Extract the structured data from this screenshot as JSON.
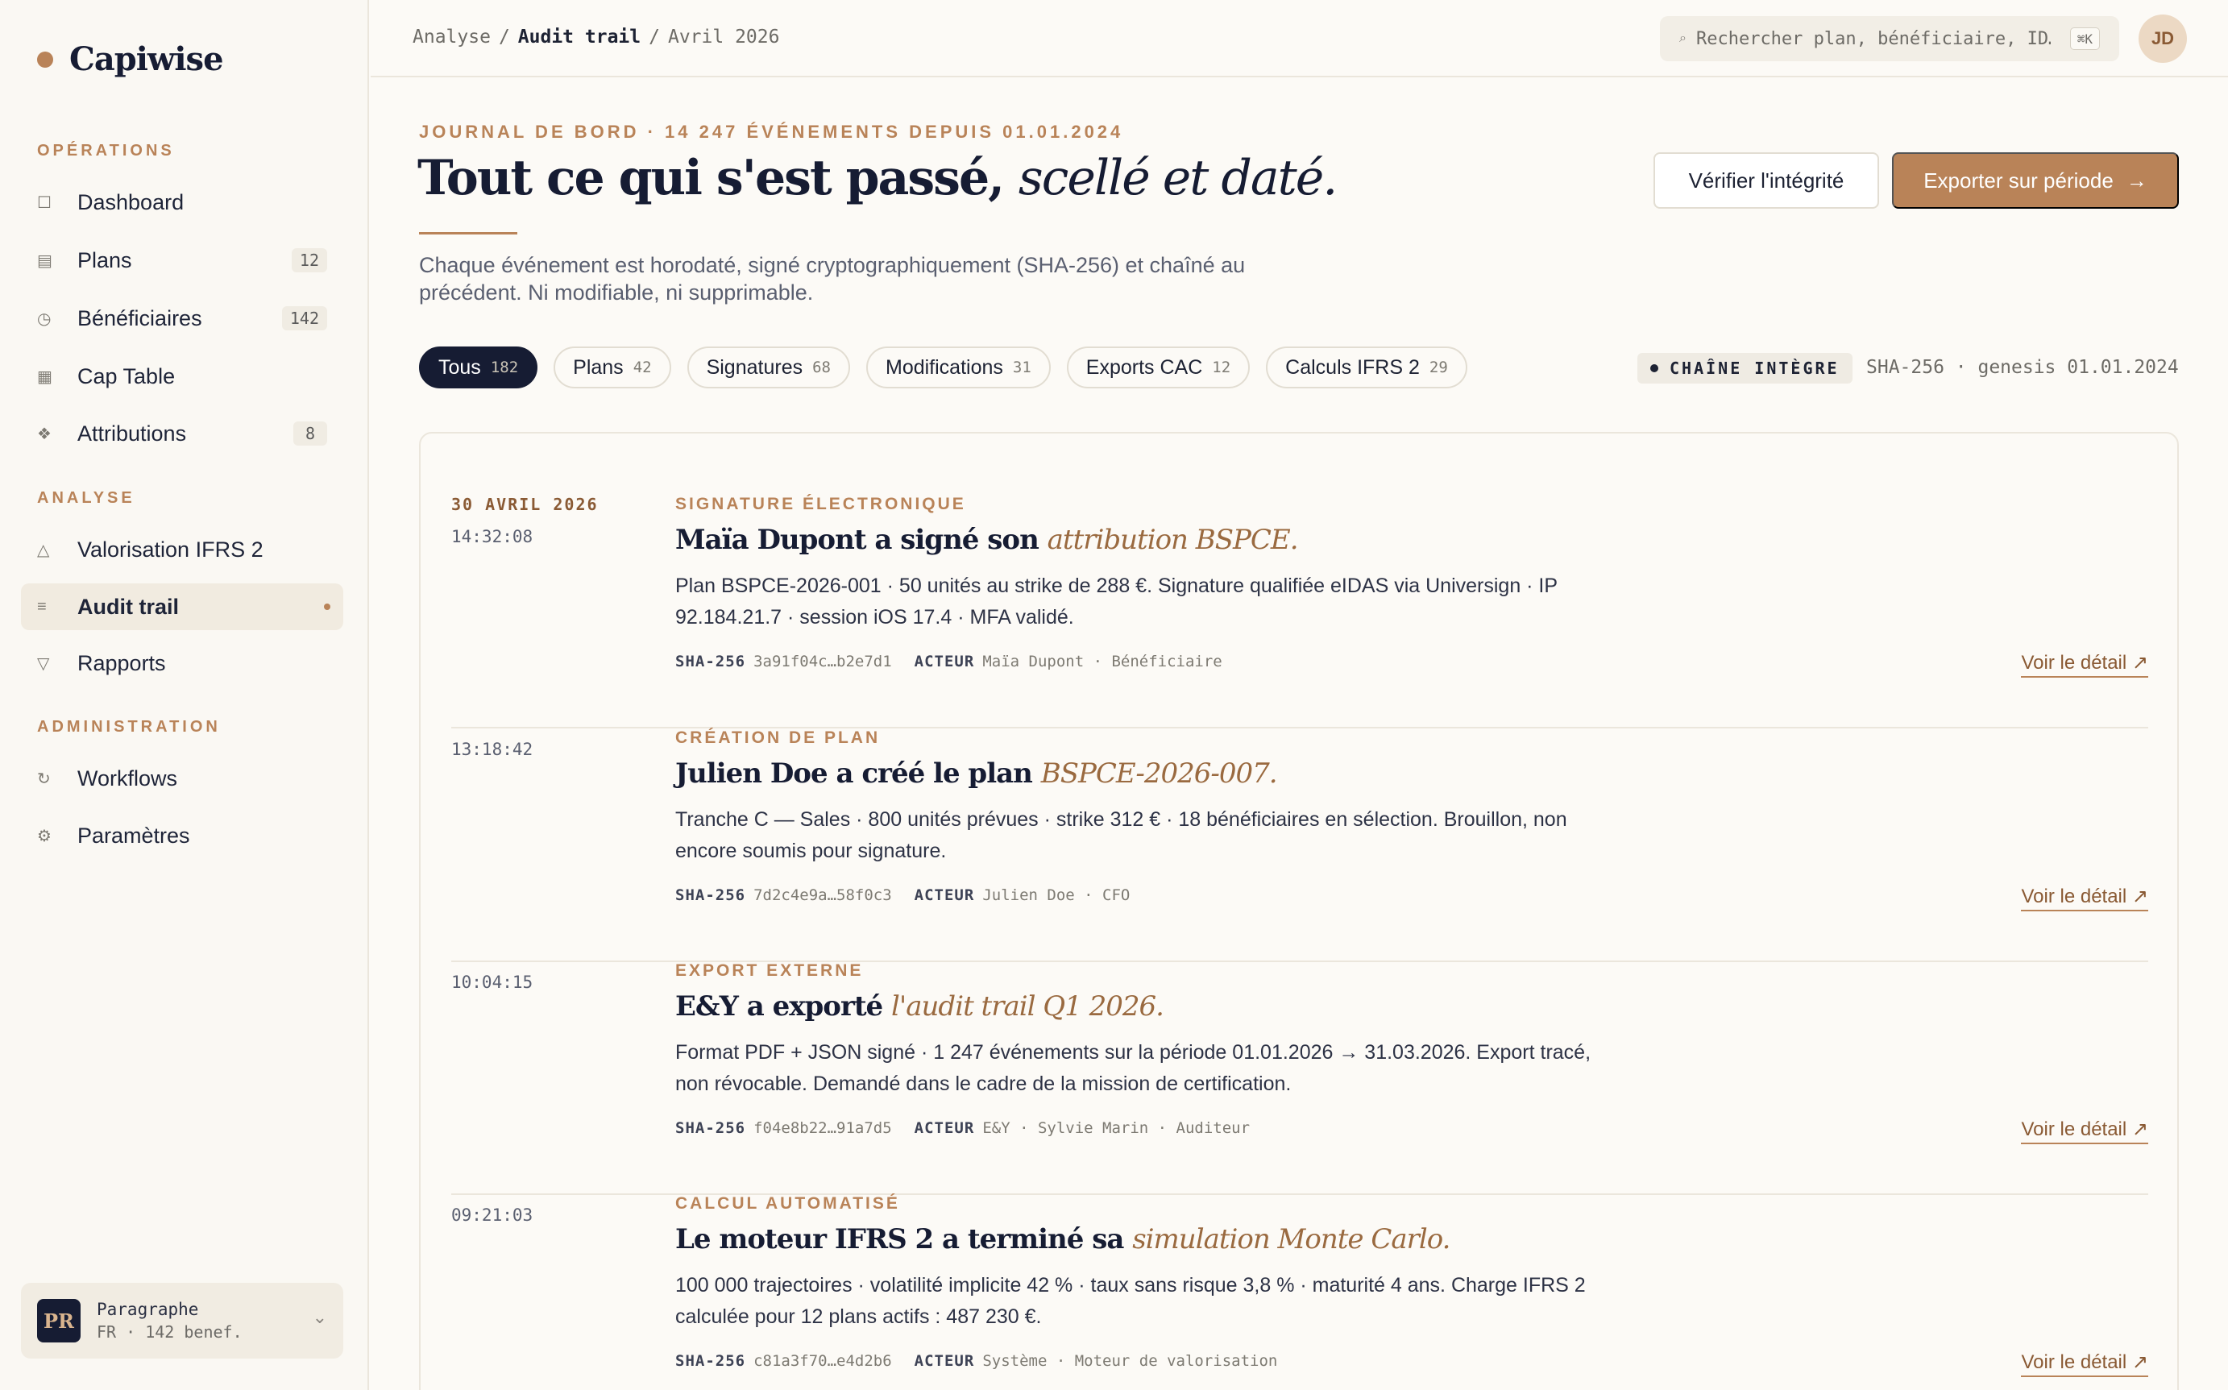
{
  "brand": {
    "name": "Capiwise"
  },
  "sidebar": {
    "sections": [
      {
        "label": "OPÉRATIONS",
        "items": [
          {
            "icon": "square-icon",
            "glyph": "☐",
            "label": "Dashboard",
            "badge": ""
          },
          {
            "icon": "plans-icon",
            "glyph": "▤",
            "label": "Plans",
            "badge": "12"
          },
          {
            "icon": "clock-icon",
            "glyph": "◷",
            "label": "Bénéficiaires",
            "badge": "142"
          },
          {
            "icon": "table-icon",
            "glyph": "▦",
            "label": "Cap Table",
            "badge": ""
          },
          {
            "icon": "attributions-icon",
            "glyph": "❖",
            "label": "Attributions",
            "badge": "8"
          }
        ]
      },
      {
        "label": "ANALYSE",
        "items": [
          {
            "icon": "triangle-icon",
            "glyph": "△",
            "label": "Valorisation IFRS 2",
            "badge": ""
          },
          {
            "icon": "list-icon",
            "glyph": "≡",
            "label": "Audit trail",
            "badge": "",
            "active": true
          },
          {
            "icon": "triangle-down-icon",
            "glyph": "▽",
            "label": "Rapports",
            "badge": ""
          }
        ]
      },
      {
        "label": "ADMINISTRATION",
        "items": [
          {
            "icon": "refresh-icon",
            "glyph": "↻",
            "label": "Workflows",
            "badge": ""
          },
          {
            "icon": "gear-icon",
            "glyph": "⚙",
            "label": "Paramètres",
            "badge": ""
          }
        ]
      }
    ],
    "workspace": {
      "initials": "PR",
      "name": "Paragraphe",
      "meta": "FR · 142 benef.",
      "chevron": "⌄"
    }
  },
  "topbar": {
    "breadcrumb": [
      "Analyse",
      "Audit trail",
      "Avril 2026"
    ],
    "search": {
      "placeholder": "Rechercher plan, bénéficiaire, ID…",
      "shortcut": "⌘K",
      "icon": "⌕"
    },
    "user_initials": "JD"
  },
  "header": {
    "eyebrow": "JOURNAL DE BORD · 14 247 ÉVÉNEMENTS DEPUIS 01.01.2024",
    "title_main": "Tout ce qui s'est passé,",
    "title_em": "scellé et daté.",
    "subtitle": "Chaque événement est horodaté, signé cryptographiquement (SHA-256) et chaîné au précédent. Ni modifiable, ni supprimable.",
    "verify_label": "Vérifier l'intégrité",
    "export_label": "Exporter sur période",
    "export_arrow": "→"
  },
  "filters": {
    "chips": [
      {
        "label": "Tous",
        "count": "182",
        "active": true
      },
      {
        "label": "Plans",
        "count": "42"
      },
      {
        "label": "Signatures",
        "count": "68"
      },
      {
        "label": "Modifications",
        "count": "31"
      },
      {
        "label": "Exports CAC",
        "count": "12"
      },
      {
        "label": "Calculs IFRS 2",
        "count": "29"
      }
    ],
    "integrity": "CHAÎNE INTÈGRE",
    "chain_meta": "SHA-256 · genesis 01.01.2024"
  },
  "events": [
    {
      "date": "30 AVRIL 2026",
      "time": "14:32:08",
      "category": "SIGNATURE ÉLECTRONIQUE",
      "title": "Maïa Dupont a signé son",
      "title_em": "attribution BSPCE.",
      "description": "Plan BSPCE-2026-001 · 50 unités au strike de 288 €. Signature qualifiée eIDAS via Universign · IP 92.184.21.7 · session iOS 17.4 · MFA validé.",
      "hash_label": "SHA-256",
      "hash": "3a91f04c…b2e7d1",
      "actor_label": "ACTEUR",
      "actor": "Maïa Dupont · Bénéficiaire",
      "link": "Voir le détail ↗"
    },
    {
      "date": "",
      "time": "13:18:42",
      "category": "CRÉATION DE PLAN",
      "title": "Julien Doe a créé le plan",
      "title_em": "BSPCE-2026-007.",
      "description": "Tranche C — Sales · 800 unités prévues · strike 312 € · 18 bénéficiaires en sélection. Brouillon, non encore soumis pour signature.",
      "hash_label": "SHA-256",
      "hash": "7d2c4e9a…58f0c3",
      "actor_label": "ACTEUR",
      "actor": "Julien Doe · CFO",
      "link": "Voir le détail ↗"
    },
    {
      "date": "",
      "time": "10:04:15",
      "category": "EXPORT EXTERNE",
      "title": "E&Y a exporté",
      "title_em": "l'audit trail Q1 2026.",
      "description": "Format PDF + JSON signé · 1 247 événements sur la période 01.01.2026 → 31.03.2026. Export tracé, non révocable. Demandé dans le cadre de la mission de certification.",
      "hash_label": "SHA-256",
      "hash": "f04e8b22…91a7d5",
      "actor_label": "ACTEUR",
      "actor": "E&Y · Sylvie Marin · Auditeur",
      "link": "Voir le détail ↗"
    },
    {
      "date": "",
      "time": "09:21:03",
      "category": "CALCUL AUTOMATISÉ",
      "title": "Le moteur IFRS 2 a terminé sa",
      "title_em": "simulation Monte Carlo.",
      "description": "100 000 trajectoires · volatilité implicite 42 % · taux sans risque 3,8 % · maturité 4 ans. Charge IFRS 2 calculée pour 12 plans actifs : 487 230 €.",
      "hash_label": "SHA-256",
      "hash": "c81a3f70…e4d2b6",
      "actor_label": "ACTEUR",
      "actor": "Système · Moteur de valorisation",
      "link": "Voir le détail ↗"
    }
  ]
}
